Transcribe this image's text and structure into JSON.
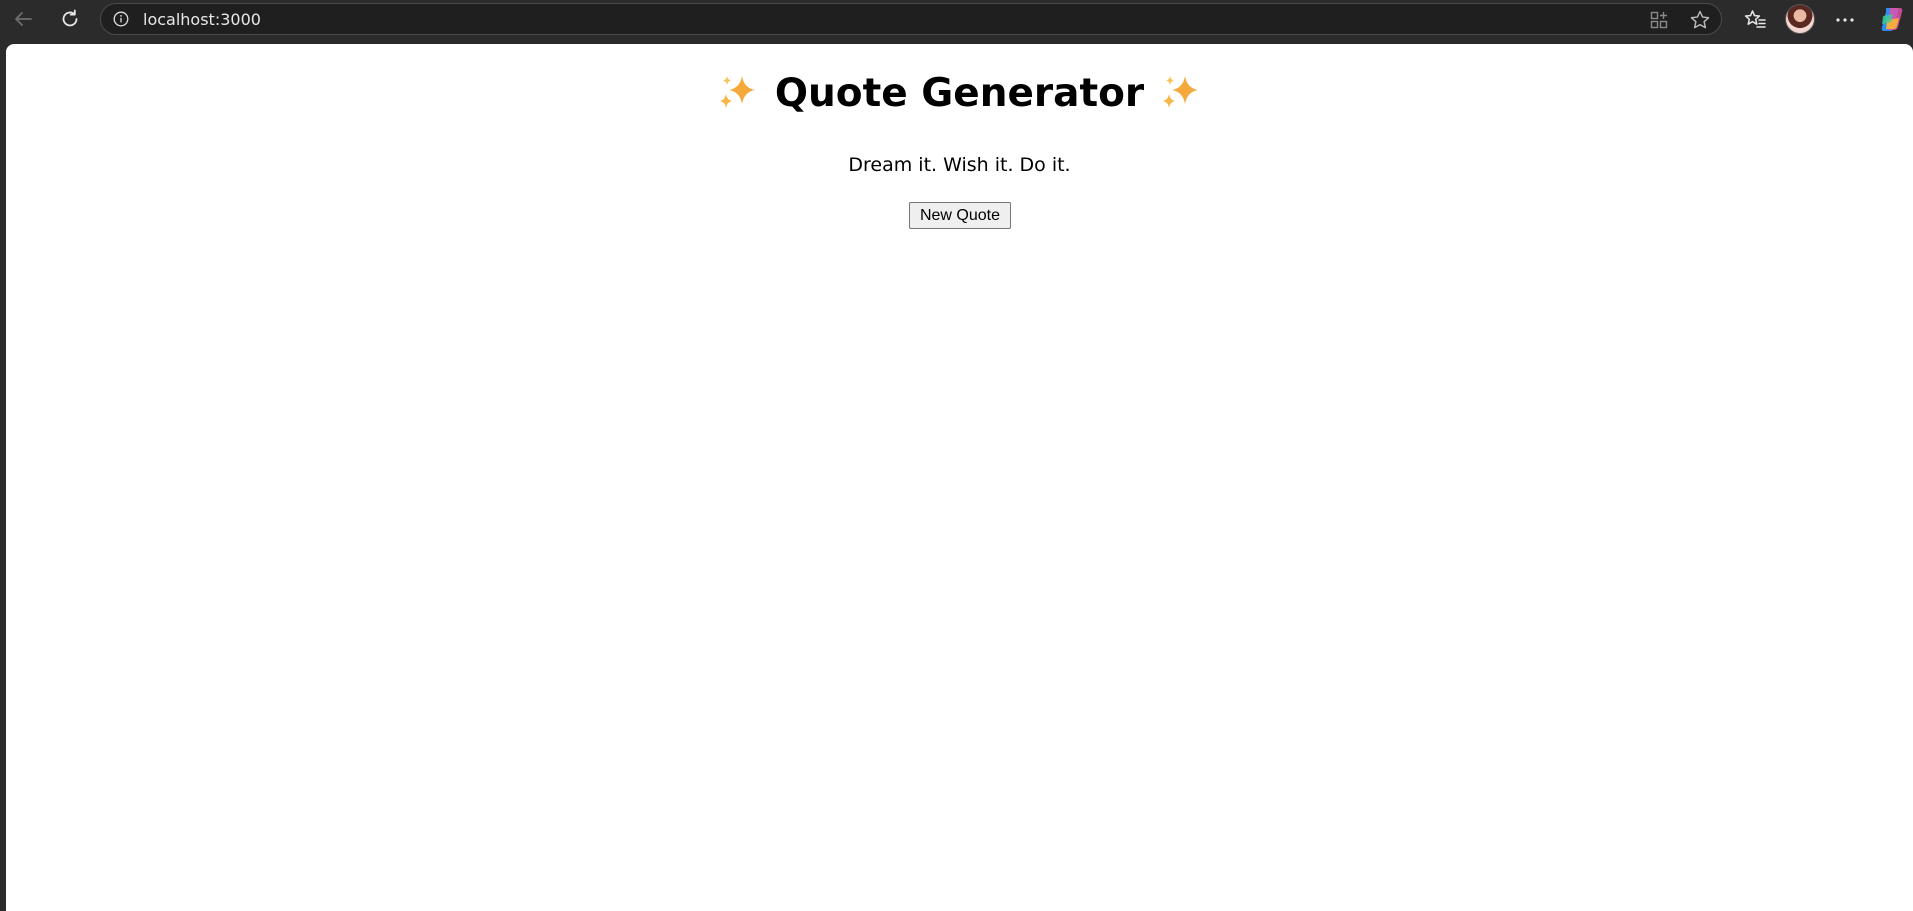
{
  "browser": {
    "url": "localhost:3000",
    "icons": {
      "back": "back-arrow-icon",
      "reload": "reload-icon",
      "site_info": "info-icon",
      "app_available": "app-available-icon",
      "favorite": "star-icon",
      "favorites": "favorites-list-icon",
      "profile": "avatar",
      "more": "more-dots-icon",
      "copilot": "copilot-icon"
    }
  },
  "page": {
    "title": "Quote Generator",
    "title_emoji": "sparkles",
    "quote": "Dream it. Wish it. Do it.",
    "button_label": "New Quote"
  },
  "colors": {
    "chrome_bg": "#2b2b2b",
    "page_bg": "#ffffff",
    "sparkle": "#f4a93a"
  }
}
